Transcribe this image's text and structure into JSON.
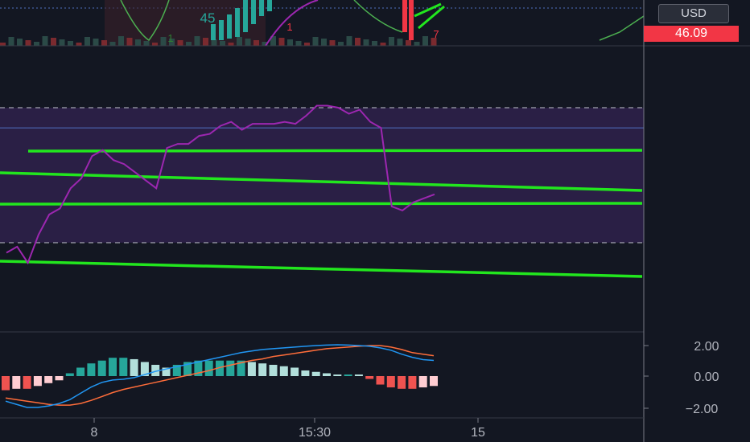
{
  "colors": {
    "background": "#131722",
    "grid": "#363a45",
    "rsi_line": "#9c27b0",
    "rsi_band_fill": "#2a1f45",
    "rsi_band_border": "#c3c6ce",
    "rsi_mid": "#4f6fbf",
    "trend_line": "#22e61e",
    "macd_line": "#2196f3",
    "signal_line": "#ff6d3a",
    "hist_pos_strong": "#26a69a",
    "hist_pos_weak": "#b2dfdb",
    "hist_neg_strong": "#ef5350",
    "hist_neg_weak": "#ffcdd2",
    "price_tag": "#f23645",
    "up_candle": "#26a69a",
    "down_candle": "#f23645"
  },
  "header": {
    "currency": "USD",
    "price_tag": "46.09",
    "marker_labels": [
      "45",
      "1",
      "1",
      "7"
    ]
  },
  "chart_data": [
    {
      "type": "line",
      "panel": "rsi",
      "x": [
        0,
        1,
        2,
        3,
        4,
        5,
        6,
        7,
        8,
        9,
        10,
        11,
        12,
        13,
        14,
        15,
        16,
        17,
        18,
        19,
        20,
        21,
        22,
        23,
        24,
        25,
        26,
        27,
        28,
        29,
        30,
        31,
        32,
        33,
        34,
        35,
        36,
        37,
        38,
        39,
        40
      ],
      "series": [
        {
          "values": [
            26,
            29,
            21,
            35,
            45,
            48,
            58,
            63,
            74,
            77,
            72,
            70,
            66,
            62,
            58,
            78,
            80,
            80,
            84,
            85,
            89,
            91,
            87,
            90,
            90,
            90,
            91,
            90,
            94,
            99,
            99,
            98,
            95,
            97,
            91,
            88,
            49,
            47,
            51,
            53,
            55
          ]
        }
      ],
      "bands": {
        "upper": 98,
        "middle": 88,
        "lower": 31
      },
      "ylim": [
        0,
        120
      ]
    },
    {
      "type": "bar",
      "panel": "macd",
      "x": [
        0,
        1,
        2,
        3,
        4,
        5,
        6,
        7,
        8,
        9,
        10,
        11,
        12,
        13,
        14,
        15,
        16,
        17,
        18,
        19,
        20,
        21,
        22,
        23,
        24,
        25,
        26,
        27,
        28,
        29,
        30,
        31,
        32,
        33,
        34,
        35,
        36,
        37,
        38,
        39,
        40
      ],
      "series": [
        {
          "name": "histogram",
          "values": [
            -0.5,
            -0.45,
            -0.45,
            -0.35,
            -0.25,
            -0.15,
            0.1,
            0.3,
            0.45,
            0.55,
            0.65,
            0.65,
            0.6,
            0.5,
            0.4,
            0.3,
            0.4,
            0.5,
            0.55,
            0.55,
            0.55,
            0.55,
            0.55,
            0.5,
            0.45,
            0.4,
            0.35,
            0.3,
            0.2,
            0.15,
            0.1,
            0.05,
            0.05,
            0.0,
            -0.1,
            -0.3,
            -0.4,
            -0.45,
            -0.45,
            -0.4,
            -0.35
          ]
        },
        {
          "name": "macd",
          "values": [
            -1.6,
            -1.8,
            -2.0,
            -2.0,
            -1.9,
            -1.75,
            -1.5,
            -1.1,
            -0.7,
            -0.4,
            -0.25,
            -0.2,
            -0.1,
            0.1,
            0.3,
            0.45,
            0.6,
            0.75,
            0.9,
            1.05,
            1.2,
            1.35,
            1.5,
            1.6,
            1.7,
            1.75,
            1.8,
            1.85,
            1.9,
            1.95,
            1.98,
            2.0,
            1.98,
            1.95,
            1.9,
            1.8,
            1.65,
            1.4,
            1.2,
            1.05,
            1.0
          ]
        },
        {
          "name": "signal",
          "values": [
            -1.4,
            -1.5,
            -1.6,
            -1.7,
            -1.8,
            -1.85,
            -1.85,
            -1.75,
            -1.55,
            -1.3,
            -1.05,
            -0.85,
            -0.7,
            -0.55,
            -0.4,
            -0.25,
            -0.1,
            0.05,
            0.2,
            0.35,
            0.55,
            0.7,
            0.85,
            1.0,
            1.1,
            1.25,
            1.35,
            1.45,
            1.55,
            1.65,
            1.75,
            1.8,
            1.85,
            1.9,
            1.95,
            1.95,
            1.85,
            1.7,
            1.5,
            1.4,
            1.3
          ]
        }
      ],
      "yticks": [
        "2.00",
        "0.00",
        "−2.00"
      ],
      "ylim": [
        -2.6,
        2.4
      ]
    }
  ],
  "x_axis": {
    "ticks": [
      "8",
      "15:30",
      "15"
    ]
  }
}
